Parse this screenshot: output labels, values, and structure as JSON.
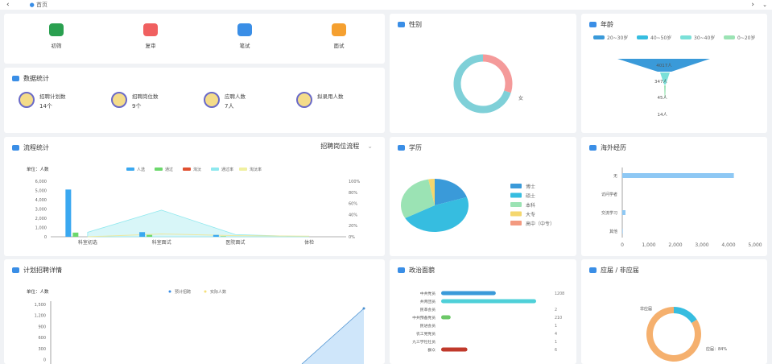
{
  "topbar": {
    "tab": "首页"
  },
  "quick": [
    {
      "label": "初筛",
      "color": "#2aa050"
    },
    {
      "label": "复审",
      "color": "#f06060"
    },
    {
      "label": "笔试",
      "color": "#3a8ee6"
    },
    {
      "label": "面试",
      "color": "#f5a030"
    }
  ],
  "stats": {
    "title": "数据统计",
    "items": [
      {
        "label": "招聘计划数",
        "value": "14个"
      },
      {
        "label": "招聘岗位数",
        "value": "9个"
      },
      {
        "label": "应聘人数",
        "value": "7人"
      },
      {
        "label": "拟录用人数",
        "value": ""
      }
    ]
  },
  "gender": {
    "title": "性别",
    "labels": [
      "",
      "女"
    ],
    "values": [
      30,
      70
    ],
    "colors": [
      "#f49a9a",
      "#7fd0d8"
    ]
  },
  "age": {
    "title": "年龄",
    "legend": [
      "20~30岁",
      "40~50岁",
      "30~40岁",
      "0~20岁"
    ],
    "colors": [
      "#3a9ad9",
      "#36bde0",
      "#7ae0d8",
      "#9be3b4"
    ],
    "funnel": [
      {
        "label": "4017人",
        "value": 4017
      },
      {
        "label": "347人",
        "value": 347
      },
      {
        "label": "45人",
        "value": 45
      },
      {
        "label": "14人",
        "value": 14
      }
    ]
  },
  "process": {
    "title": "流程统计",
    "dropdown": "招聘岗位流程",
    "unit": "单位：人数"
  },
  "education": {
    "title": "学历",
    "legend": [
      "博士",
      "硕士",
      "本科",
      "大专",
      "高中（中专）"
    ],
    "colors": [
      "#3a9ad9",
      "#36bde0",
      "#9be3b4",
      "#f5d76e",
      "#f39a80"
    ],
    "values": [
      20,
      47,
      30,
      3,
      0
    ]
  },
  "overseas": {
    "title": "海外经历",
    "categories": [
      "无",
      "访问学者",
      "交流学习",
      "其他"
    ],
    "values": [
      4200,
      0,
      120,
      20
    ],
    "ticks": [
      "0",
      "1,000",
      "2,000",
      "3,000",
      "4,000",
      "5,000"
    ]
  },
  "plan": {
    "title": "计划招聘详情",
    "unit": "单位：人数",
    "legend": [
      "预计招聘",
      "实际人数"
    ],
    "ticks": [
      "1,500",
      "1,200",
      "900",
      "600",
      "300",
      "0"
    ]
  },
  "political": {
    "title": "政治面貌",
    "rows": [
      {
        "label": "中共党员",
        "value": "1208",
        "n": 1208,
        "color": "#3a9ad9"
      },
      {
        "label": "共青团员",
        "value": "",
        "n": 2100,
        "color": "#4fd0d8"
      },
      {
        "label": "民革会员",
        "value": "2",
        "n": 2,
        "color": "#999"
      },
      {
        "label": "中共预备党员",
        "value": "210",
        "n": 210,
        "color": "#6cc868"
      },
      {
        "label": "民进会员",
        "value": "1",
        "n": 1,
        "color": "#999"
      },
      {
        "label": "农工党党员",
        "value": "4",
        "n": 4,
        "color": "#999"
      },
      {
        "label": "九三学社社员",
        "value": "1",
        "n": 1,
        "color": "#999"
      },
      {
        "label": "群众",
        "value": "6",
        "n": 580,
        "color": "#c0392b"
      }
    ]
  },
  "fresh": {
    "title": "应届 / 非应届",
    "labels": [
      "非应届",
      "应届：84%"
    ],
    "values": [
      16,
      84
    ],
    "colors": [
      "#36bde0",
      "#f5b06e"
    ]
  },
  "chart_data": [
    {
      "type": "bar",
      "title": "流程统计",
      "categories": [
        "科室初选",
        "科室面试",
        "医院面试",
        "体检"
      ],
      "ylim": [
        0,
        6000
      ],
      "yticks": [
        "6,000",
        "5,000",
        "4,000",
        "3,000",
        "2,000",
        "1,000",
        "0"
      ],
      "y2ticks": [
        "100%",
        "80%",
        "60%",
        "40%",
        "20%",
        "0%"
      ],
      "legend": [
        "人选",
        "通过",
        "淘汰",
        "通过率",
        "淘汰率"
      ],
      "series": [
        {
          "name": "人选",
          "values": [
            5100,
            500,
            200,
            0
          ],
          "color": "#3aa8f0"
        },
        {
          "name": "通过",
          "values": [
            450,
            200,
            50,
            0
          ],
          "color": "#6cd86c"
        },
        {
          "name": "淘汰",
          "values": [
            0,
            0,
            0,
            0
          ],
          "color": "#e05030"
        },
        {
          "name": "通过率",
          "values": [
            8,
            48,
            4,
            0
          ],
          "color": "#8ee8ee"
        },
        {
          "name": "淘汰率",
          "values": [
            0,
            5,
            2,
            1
          ],
          "color": "#f0f0a0"
        }
      ]
    },
    {
      "type": "line",
      "title": "计划招聘详情",
      "ylim": [
        0,
        1500
      ],
      "series": [
        {
          "name": "预计招聘",
          "values": [
            0,
            0,
            0,
            0,
            0,
            1400
          ]
        },
        {
          "name": "实际人数",
          "values": [
            0,
            0,
            0,
            0,
            0,
            0
          ]
        }
      ]
    }
  ]
}
